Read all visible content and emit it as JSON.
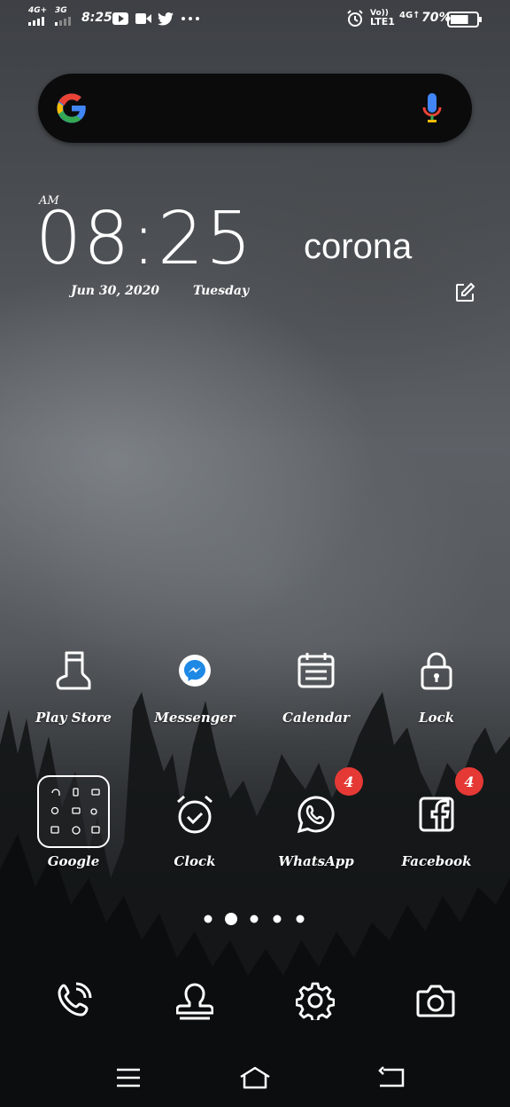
{
  "status_bar": {
    "signal_1_label": "4G+",
    "signal_2_label": "3G",
    "time": "8:25",
    "notif_icons": [
      "youtube-icon",
      "video-camera-icon",
      "twitter-icon",
      "more-dots-icon"
    ],
    "volte_label": "Vo))",
    "lte_label": "LTE1",
    "net_label": "4G↑",
    "battery_percent": "70%",
    "battery_level": 0.7
  },
  "search": {
    "logo": "google-logo",
    "mic": "microphone-icon",
    "colors": {
      "blue": "#4285F4",
      "red": "#EA4335",
      "yellow": "#FBBC05",
      "green": "#34A853"
    }
  },
  "clock_widget": {
    "ampm": "AM",
    "time": "08:25",
    "date": "Jun 30, 2020",
    "weekday": "Tuesday"
  },
  "note_widget": {
    "text": "corona",
    "edit_icon": "edit-note-icon"
  },
  "apps": [
    {
      "label": "Play Store",
      "icon": "boot-icon",
      "badge": ""
    },
    {
      "label": "Messenger",
      "icon": "messenger-icon",
      "badge": ""
    },
    {
      "label": "Calendar",
      "icon": "calendar-icon",
      "badge": ""
    },
    {
      "label": "Lock",
      "icon": "lock-icon",
      "badge": ""
    },
    {
      "label": "Google",
      "icon": "folder-icon",
      "badge": ""
    },
    {
      "label": "Clock",
      "icon": "alarm-clock-icon",
      "badge": ""
    },
    {
      "label": "WhatsApp",
      "icon": "whatsapp-icon",
      "badge": "4"
    },
    {
      "label": "Facebook",
      "icon": "facebook-icon",
      "badge": "4"
    }
  ],
  "page_indicator": {
    "pages": 5,
    "current": 2
  },
  "dock": [
    "phone-icon",
    "contacts-icon",
    "settings-gear-icon",
    "camera-icon"
  ],
  "nav_bar": [
    "menu-icon",
    "home-icon",
    "back-icon"
  ],
  "colors": {
    "badge": "#E53935",
    "messenger": "#1E88E5",
    "search_bg": "#0B0B0C"
  }
}
